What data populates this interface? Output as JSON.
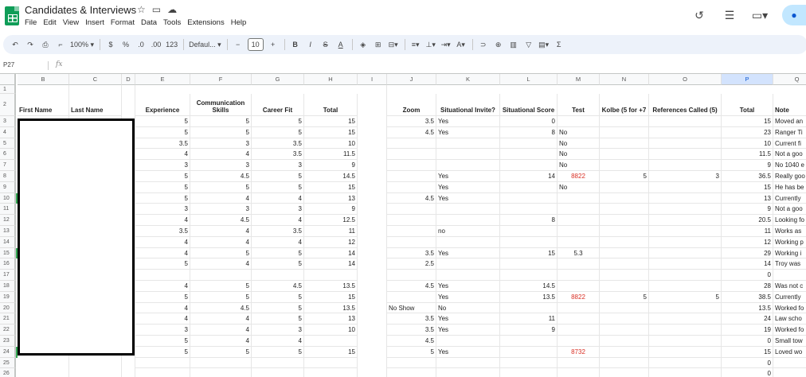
{
  "app": {
    "title": "Candidates & Interviews",
    "menu": [
      "File",
      "Edit",
      "View",
      "Insert",
      "Format",
      "Data",
      "Tools",
      "Extensions",
      "Help"
    ],
    "title_icons": [
      "star-icon",
      "move-folder-icon",
      "cloud-status-icon"
    ],
    "right_icons": [
      "history-icon",
      "comments-icon",
      "meet-icon"
    ]
  },
  "toolbar": {
    "zoom": "100%",
    "currency": "$",
    "percent": "%",
    "dec_decrease": ".0",
    "dec_increase": ".00",
    "number_format": "123",
    "font": "Defaul...",
    "font_size": "10",
    "minus": "−",
    "plus": "+",
    "bold": "B",
    "italic": "I",
    "strike": "S",
    "text_color": "A",
    "sigma": "Σ"
  },
  "formula_bar": {
    "cell_ref": "P27",
    "fx": "fx",
    "value": ""
  },
  "columns": [
    "A",
    "B",
    "C",
    "D",
    "E",
    "F",
    "G",
    "H",
    "I",
    "J",
    "K",
    "L",
    "M",
    "N",
    "O",
    "P",
    "Q"
  ],
  "selected_column": "P",
  "headers": {
    "B": "First Name",
    "C": "Last Name",
    "E": "Experience",
    "F": "Communication Skills",
    "G": "Career Fit",
    "H": "Total",
    "J": "Zoom",
    "K": "Situational Invite?",
    "L": "Situational Score",
    "M": "Test",
    "N": "Kolbe (5 for +7",
    "O": "References Called (5)",
    "P": "Total",
    "Q": "Note"
  },
  "rows": [
    {
      "n": "3",
      "E": "5",
      "F": "5",
      "G": "5",
      "H": "15",
      "J": "3.5",
      "K": "Yes",
      "L": "0",
      "M": "",
      "N": "",
      "O": "",
      "P": "15",
      "Q": "Moved an"
    },
    {
      "n": "4",
      "E": "5",
      "F": "5",
      "G": "5",
      "H": "15",
      "J": "4.5",
      "K": "Yes",
      "L": "8",
      "M": "No",
      "N": "",
      "O": "",
      "P": "23",
      "Q": "Ranger Ti"
    },
    {
      "n": "5",
      "E": "3.5",
      "F": "3",
      "G": "3.5",
      "H": "10",
      "J": "",
      "K": "",
      "L": "",
      "M": "No",
      "N": "",
      "O": "",
      "P": "10",
      "Q": "Current fi"
    },
    {
      "n": "6",
      "E": "4",
      "F": "4",
      "G": "3.5",
      "H": "11.5",
      "J": "",
      "K": "",
      "L": "",
      "M": "No",
      "N": "",
      "O": "",
      "P": "11.5",
      "Q": "Not a goo"
    },
    {
      "n": "7",
      "E": "3",
      "F": "3",
      "G": "3",
      "H": "9",
      "J": "",
      "K": "",
      "L": "",
      "M": "No",
      "N": "",
      "O": "",
      "P": "9",
      "Q": "No 1040 e"
    },
    {
      "n": "8",
      "E": "5",
      "F": "4.5",
      "G": "5",
      "H": "14.5",
      "J": "",
      "K": "Yes",
      "L": "14",
      "M": "8822",
      "N": "5",
      "O": "3",
      "P": "36.5",
      "Q": "Really goo"
    },
    {
      "n": "9",
      "E": "5",
      "F": "5",
      "G": "5",
      "H": "15",
      "J": "",
      "K": "Yes",
      "L": "",
      "M": "No",
      "N": "",
      "O": "",
      "P": "15",
      "Q": "He has be"
    },
    {
      "n": "10",
      "E": "5",
      "F": "4",
      "G": "4",
      "H": "13",
      "J": "4.5",
      "K": "Yes",
      "L": "",
      "M": "",
      "N": "",
      "O": "",
      "P": "13",
      "Q": "Currently"
    },
    {
      "n": "11",
      "E": "3",
      "F": "3",
      "G": "3",
      "H": "9",
      "J": "",
      "K": "",
      "L": "",
      "M": "",
      "N": "",
      "O": "",
      "P": "9",
      "Q": "Not a goo"
    },
    {
      "n": "12",
      "E": "4",
      "F": "4.5",
      "G": "4",
      "H": "12.5",
      "J": "",
      "K": "",
      "L": "8",
      "M": "",
      "N": "",
      "O": "",
      "P": "20.5",
      "Q": "Looking fo"
    },
    {
      "n": "13",
      "E": "3.5",
      "F": "4",
      "G": "3.5",
      "H": "11",
      "J": "",
      "K": "no",
      "L": "",
      "M": "",
      "N": "",
      "O": "",
      "P": "11",
      "Q": "Works as"
    },
    {
      "n": "14",
      "E": "4",
      "F": "4",
      "G": "4",
      "H": "12",
      "J": "",
      "K": "",
      "L": "",
      "M": "",
      "N": "",
      "O": "",
      "P": "12",
      "Q": "Working p"
    },
    {
      "n": "15",
      "E": "4",
      "F": "5",
      "G": "5",
      "H": "14",
      "J": "3.5",
      "K": "Yes",
      "L": "15",
      "M": "5.3",
      "N": "",
      "O": "",
      "P": "29",
      "Q": "Working i"
    },
    {
      "n": "16",
      "E": "5",
      "F": "4",
      "G": "5",
      "H": "14",
      "J": "2.5",
      "K": "",
      "L": "",
      "M": "",
      "N": "",
      "O": "",
      "P": "14",
      "Q": "Troy was"
    },
    {
      "n": "17",
      "E": "",
      "F": "",
      "G": "",
      "H": "",
      "J": "",
      "K": "",
      "L": "",
      "M": "",
      "N": "",
      "O": "",
      "P": "0",
      "Q": ""
    },
    {
      "n": "18",
      "E": "4",
      "F": "5",
      "G": "4.5",
      "H": "13.5",
      "J": "4.5",
      "K": "Yes",
      "L": "14.5",
      "M": "",
      "N": "",
      "O": "",
      "P": "28",
      "Q": "Was not c"
    },
    {
      "n": "19",
      "E": "5",
      "F": "5",
      "G": "5",
      "H": "15",
      "J": "",
      "K": "Yes",
      "L": "13.5",
      "M": "8822",
      "N": "5",
      "O": "5",
      "P": "38.5",
      "Q": "Currently"
    },
    {
      "n": "20",
      "E": "4",
      "F": "4.5",
      "G": "5",
      "H": "13.5",
      "J": "No Show",
      "K": "No",
      "L": "",
      "M": "",
      "N": "",
      "O": "",
      "P": "13.5",
      "Q": "Worked fo"
    },
    {
      "n": "21",
      "E": "4",
      "F": "4",
      "G": "5",
      "H": "13",
      "J": "3.5",
      "K": "Yes",
      "L": "11",
      "M": "",
      "N": "",
      "O": "",
      "P": "24",
      "Q": "Law scho"
    },
    {
      "n": "22",
      "E": "3",
      "F": "4",
      "G": "3",
      "H": "10",
      "J": "3.5",
      "K": "Yes",
      "L": "9",
      "M": "",
      "N": "",
      "O": "",
      "P": "19",
      "Q": "Worked fo"
    },
    {
      "n": "23",
      "E": "5",
      "F": "4",
      "G": "4",
      "H": "",
      "J": "4.5",
      "K": "",
      "L": "",
      "M": "",
      "N": "",
      "O": "",
      "P": "0",
      "Q": "Small tow"
    },
    {
      "n": "24",
      "E": "5",
      "F": "5",
      "G": "5",
      "H": "15",
      "J": "5",
      "K": "Yes",
      "L": "",
      "M": "8732",
      "N": "",
      "O": "",
      "P": "15",
      "Q": "Loved wo"
    },
    {
      "n": "25",
      "E": "",
      "F": "",
      "G": "",
      "H": "",
      "J": "",
      "K": "",
      "L": "",
      "M": "",
      "N": "",
      "O": "",
      "P": "0",
      "Q": ""
    },
    {
      "n": "26",
      "E": "",
      "F": "",
      "G": "",
      "H": "",
      "J": "",
      "K": "",
      "L": "",
      "M": "",
      "N": "",
      "O": "",
      "P": "0",
      "Q": ""
    }
  ],
  "colors": {
    "sheets_green": "#0f9d58",
    "selected_column_bg": "#d3e3fd",
    "test_value_red": "#d93025",
    "toolbar_bg": "#edf2fa",
    "redaction_box": "#000000"
  }
}
